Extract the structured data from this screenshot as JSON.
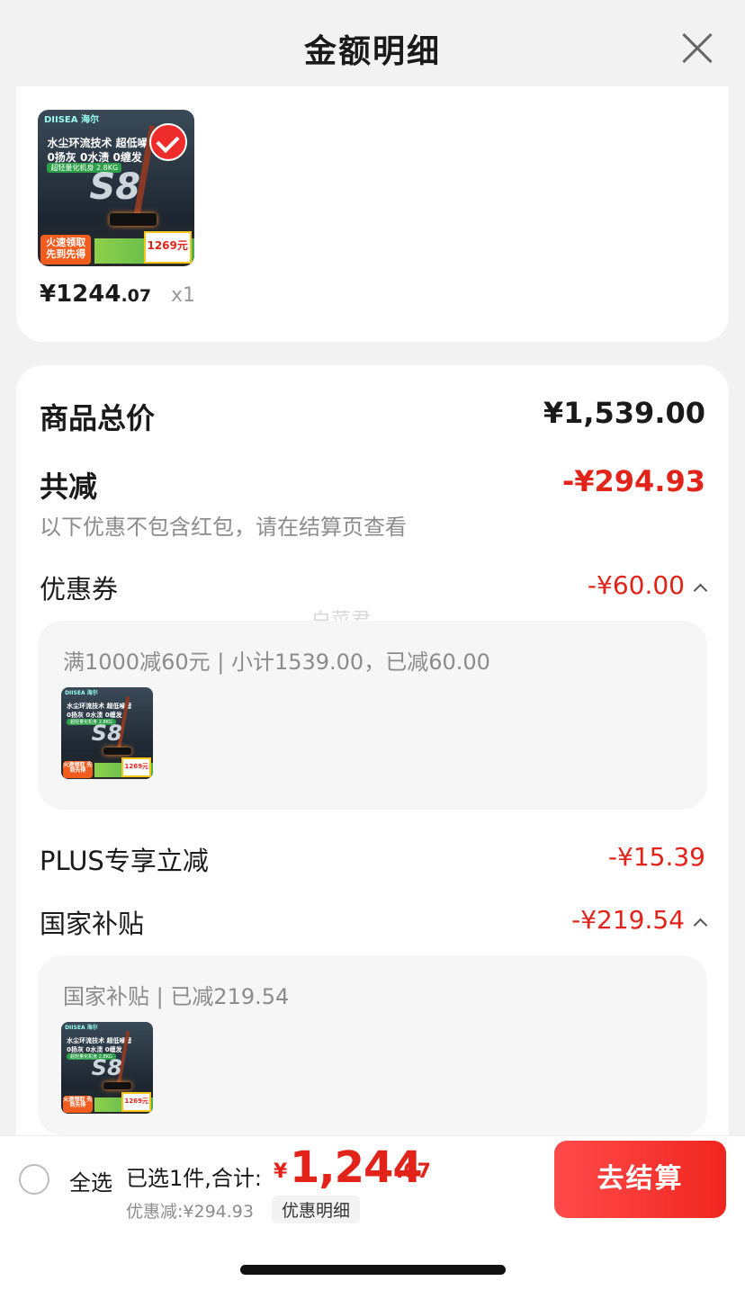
{
  "header": {
    "title": "金额明细"
  },
  "product": {
    "image": {
      "brand": "DIISEA 海尔",
      "line1": "水尘环流技术 超低噪音",
      "line2": "0扬灰 0水渍 0缠发",
      "tag": "超轻量化机身 2.8KG",
      "model": "S8",
      "promo": "火速领取 先到先得",
      "price_tag": "1269元"
    },
    "price_int": "¥1244",
    "price_dec": ".07",
    "qty": "x1"
  },
  "summary": {
    "total_label": "商品总价",
    "total_value": "¥1,539.00",
    "reduce_label": "共减",
    "reduce_value": "-¥294.93",
    "reduce_note": "以下优惠不包含红包，请在结算页查看"
  },
  "coupon": {
    "label": "优惠券",
    "value": "-¥60.00",
    "detail": "满1000减60元 | 小计1539.00，已减60.00"
  },
  "plus": {
    "label": "PLUS专享立减",
    "value": "-¥15.39"
  },
  "subsidy": {
    "label": "国家补贴",
    "value": "-¥219.54",
    "detail": "国家补贴 | 已减219.54"
  },
  "watermark": "白菜君",
  "bottom_bar": {
    "select_all": "全选",
    "selected_info": "已选1件,合计:",
    "total_currency": "¥",
    "total_int": "1,244",
    "total_dec": ".07",
    "discount": "优惠减:¥294.93",
    "detail_link": "优惠明细",
    "checkout": "去结算"
  },
  "colors": {
    "accent_red": "#e2231a",
    "checkout_start": "#ff4b4b",
    "checkout_end": "#f0261f"
  },
  "icons": [
    "close-icon",
    "checkmark-icon",
    "chevron-up-icon",
    "radio-icon"
  ]
}
